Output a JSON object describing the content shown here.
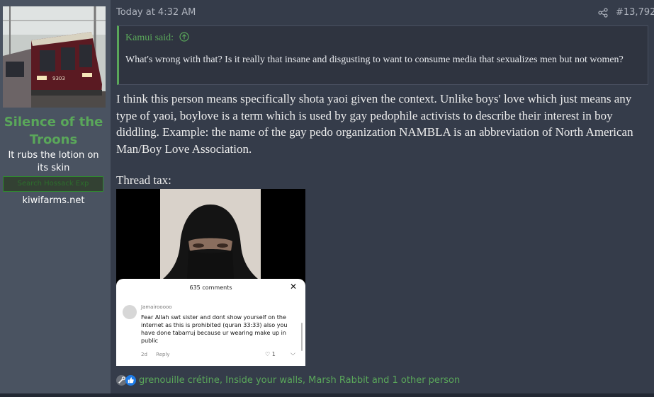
{
  "user": {
    "name": "Silence of the Troons",
    "title": "It rubs the lotion on its skin",
    "badge": "Search Hossack Exp",
    "site": "kiwifarms.net",
    "avatar_train_number": "9303"
  },
  "post": {
    "timestamp": "Today at 4:32 AM",
    "number": "#13,792",
    "quote": {
      "author": "Kamui said:",
      "text": "What's wrong with that? Is it really that insane and disgusting to want to consume media that sexualizes men but not women?"
    },
    "body": "I think this person means specifically shota yaoi given the context. Unlike boys' love which just means any type of yaoi, boylove is a term which is used by gay pedophile activists to describe their interest in boy diddling. Example: the name of the gay pedo organization NAMBLA is an abbreviation of North American Man/Boy Love Association.",
    "thread_tax": "Thread tax:"
  },
  "attachment": {
    "comments_title": "635 comments",
    "close": "✕",
    "commenter": "Jamairooooo",
    "comment": "Fear Allah swt sister and dont show yourself on the internet as this is prohibited (quran 33:33) also you have done tabarruj because ur wearing make up in public",
    "age": "2d",
    "reply": "Reply",
    "likes": "1"
  },
  "reactions": {
    "icons": [
      "tools-icon",
      "thumbs-up-icon"
    ],
    "text": "grenouille crétine, Inside your walls, Marsh Rabbit and 1 other person"
  },
  "colors": {
    "background": "#353c4a",
    "sidebar": "#4a5361",
    "accent_green": "#5aa75a",
    "quote_bg": "#2f3440"
  }
}
